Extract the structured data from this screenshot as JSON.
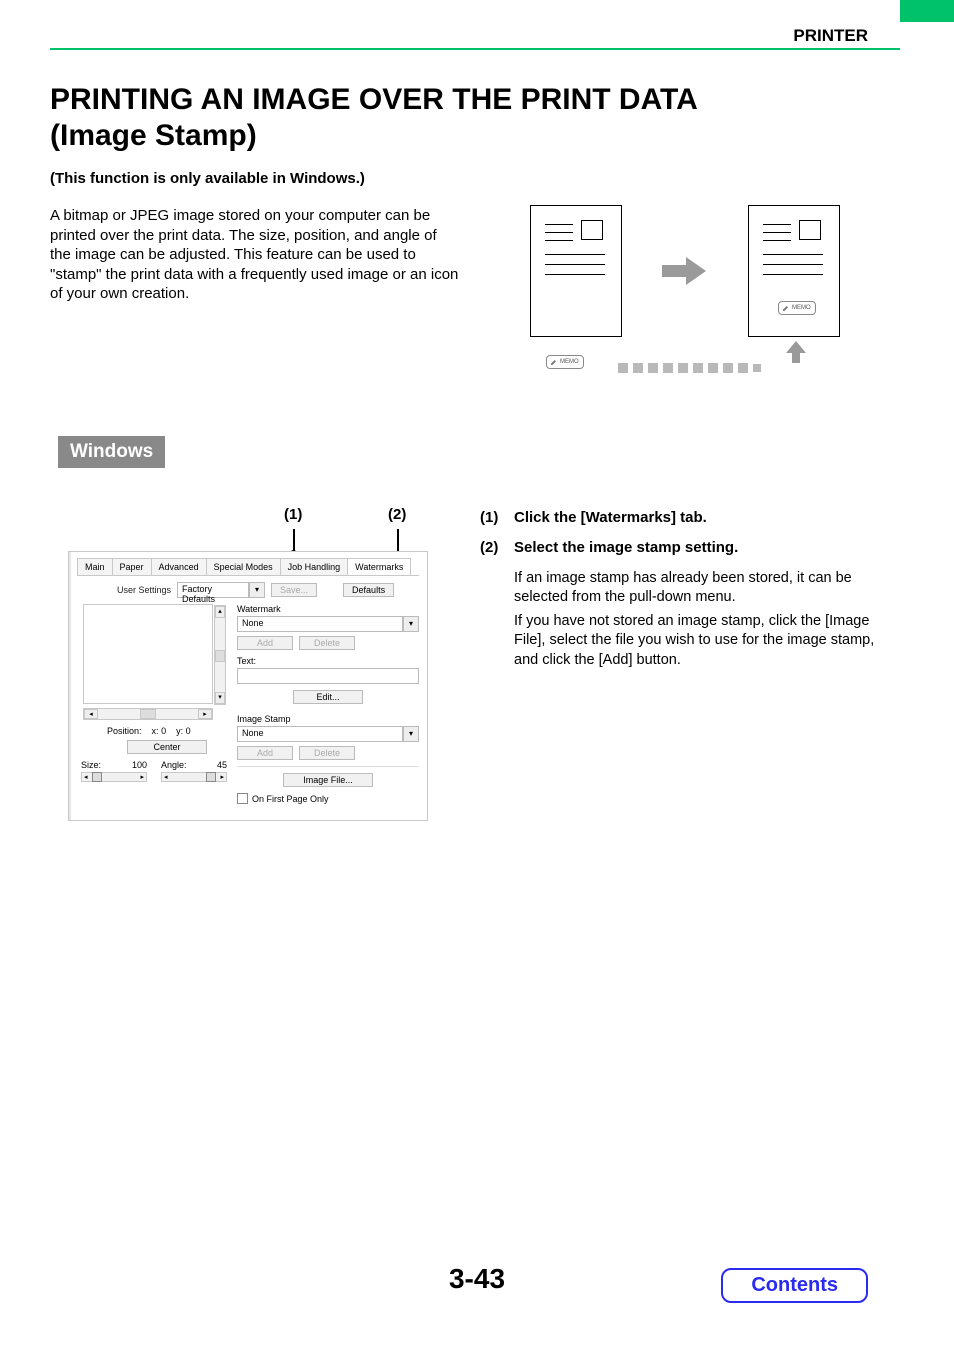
{
  "header": {
    "section": "PRINTER"
  },
  "title_line1": "PRINTING AN IMAGE OVER THE PRINT DATA",
  "title_line2": "(Image Stamp)",
  "subtitle": "(This function is only available in Windows.)",
  "intro": "A bitmap or JPEG image stored on your computer can be printed over the print data. The size, position, and angle of the image can be adjusted. This feature can be used to \"stamp\" the print data with a frequently used image or an icon of your own creation.",
  "illustration": {
    "memo_label": "MEMO"
  },
  "os_chip": "Windows",
  "callouts": {
    "one": "(1)",
    "two": "(2)"
  },
  "dialog": {
    "tabs": [
      "Main",
      "Paper",
      "Advanced",
      "Special Modes",
      "Job Handling",
      "Watermarks"
    ],
    "user_settings_label": "User Settings",
    "factory_defaults_label": "Factory Defaults",
    "save_btn": "Save...",
    "defaults_btn": "Defaults",
    "position_label": "Position:",
    "pos_x_label": "x:",
    "pos_x_val": "0",
    "pos_y_label": "y:",
    "pos_y_val": "0",
    "center_btn": "Center",
    "size_label": "Size:",
    "size_val": "100",
    "angle_label": "Angle:",
    "angle_val": "45",
    "watermark_group": "Watermark",
    "watermark_value": "None",
    "add_btn": "Add",
    "delete_btn": "Delete",
    "text_label": "Text:",
    "edit_btn": "Edit...",
    "image_stamp_group": "Image Stamp",
    "image_stamp_value": "None",
    "image_file_btn": "Image File...",
    "first_page_only": "On First Page Only"
  },
  "steps": {
    "s1_num": "(1)",
    "s1_title": "Click the [Watermarks] tab.",
    "s2_num": "(2)",
    "s2_title": "Select the image stamp setting.",
    "s2_body1": "If an image stamp has already been stored, it can be selected from the pull-down menu.",
    "s2_body2": "If you have not stored an image stamp, click the [Image File], select the file you wish to use for the image stamp, and click the [Add] button."
  },
  "page_number": "3-43",
  "contents_link": "Contents"
}
